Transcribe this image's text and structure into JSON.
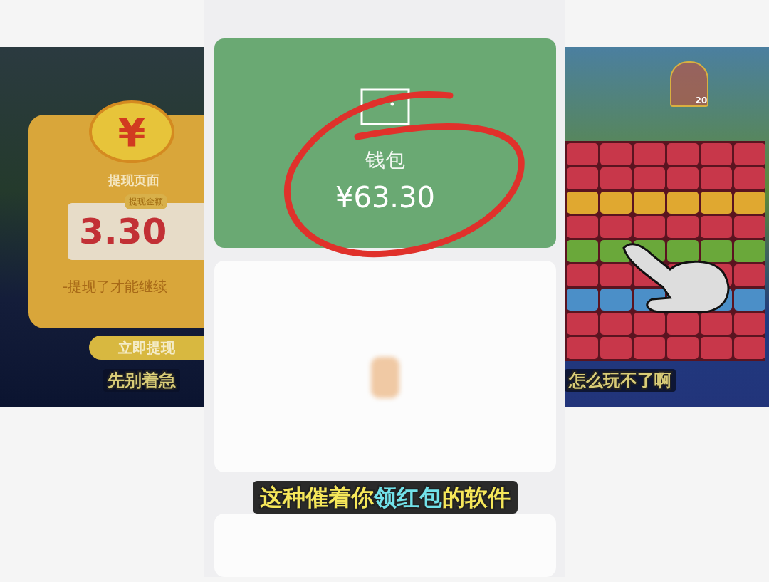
{
  "left_frame": {
    "coin_symbol": "¥",
    "title": "提现页面",
    "amount_label": "提现金额",
    "amount": "3.30",
    "note": "-提现了才能继续",
    "button": "立即提现",
    "caption": "先别着急"
  },
  "center_frame": {
    "wallet": {
      "label": "钱包",
      "balance": "¥63.30"
    },
    "caption": [
      {
        "text": "这种催着你",
        "highlight": false
      },
      {
        "text": "领红包",
        "highlight": true
      },
      {
        "text": "的软件",
        "highlight": false
      }
    ]
  },
  "right_frame": {
    "cage_count": "20",
    "caption": "怎么玩不了啊"
  }
}
